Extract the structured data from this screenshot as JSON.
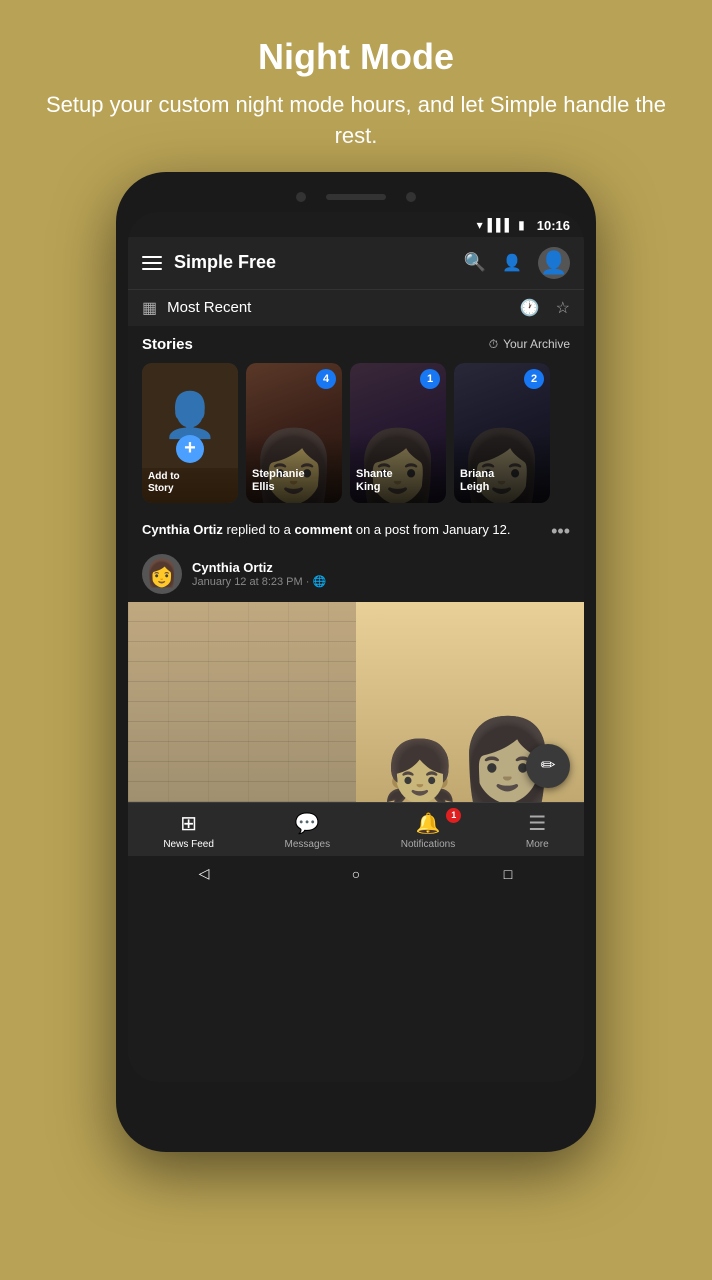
{
  "page": {
    "title": "Night Mode",
    "subtitle": "Setup your custom night mode hours, and let Simple handle the rest."
  },
  "statusBar": {
    "time": "10:16"
  },
  "appHeader": {
    "title": "Simple Free"
  },
  "filterBar": {
    "label": "Most Recent"
  },
  "stories": {
    "title": "Stories",
    "archiveLabel": "Your Archive",
    "addLabel": "Add to\nStory",
    "items": [
      {
        "name": "Stephanie\nEllis",
        "count": "4"
      },
      {
        "name": "Shante\nKing",
        "count": "1"
      },
      {
        "name": "Briana\nLeigh",
        "count": "2"
      }
    ]
  },
  "post": {
    "description": "Cynthia Ortiz replied to a comment on a post from January 12.",
    "authorName": "Cynthia Ortiz",
    "postMeta": "January 12 at 8:23 PM · 🌐"
  },
  "bottomNav": {
    "items": [
      {
        "label": "News Feed",
        "active": true
      },
      {
        "label": "Messages",
        "active": false
      },
      {
        "label": "Notifications",
        "active": false,
        "badge": "1"
      },
      {
        "label": "More",
        "active": false
      }
    ]
  },
  "icons": {
    "hamburger": "☰",
    "search": "🔍",
    "addFriend": "👤+",
    "clock": "🕐",
    "star": "☆",
    "archiveClock": "⏱",
    "more": "•••",
    "globe": "🌐",
    "pencil": "✏",
    "back": "◁",
    "home": "○",
    "recent": "□"
  }
}
